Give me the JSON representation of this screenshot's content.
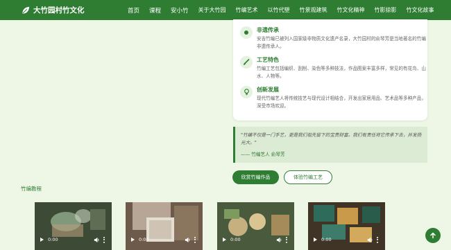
{
  "brand": {
    "title": "大竹园村竹文化",
    "icon": "leaf-icon"
  },
  "nav": {
    "items": [
      {
        "label": "首页",
        "strong": true
      },
      {
        "label": "课程",
        "strong": true
      },
      {
        "label": "安小竹",
        "strong": true
      },
      {
        "label": "关于大竹园",
        "strong": false
      },
      {
        "label": "竹编艺术",
        "strong": false
      },
      {
        "label": "以竹代塑",
        "strong": false
      },
      {
        "label": "竹景观建筑",
        "strong": false
      },
      {
        "label": "竹文化精神",
        "strong": false
      },
      {
        "label": "竹影掠影",
        "strong": false
      },
      {
        "label": "竹文化故事",
        "strong": false
      }
    ]
  },
  "features": [
    {
      "icon": "dot-icon",
      "title": "非遗传承",
      "desc": "安吉竹编已被列入国家级非物质文化遗产名录，大竹园村的俞琴芳是当地著名的竹编非遗传承人。"
    },
    {
      "icon": "brush-icon",
      "title": "工艺特色",
      "desc": "竹编工艺包括编织、刮削、染色等多种技法，作品图案丰富多样，常见的有花鸟、山水、人物等。"
    },
    {
      "icon": "lightbulb-icon",
      "title": "创新发展",
      "desc": "现代竹编艺人将传统技艺与现代设计相结合，开发出家居用品、艺术品等多种产品，深受市场欢迎。"
    }
  ],
  "quote": {
    "text": "\"竹编不仅是一门手艺，更是我们祖先留下的宝贵财富。我们有责任将它传承下去，并发扬光大。\"",
    "author": "—— 竹编艺人 俞琴芳"
  },
  "buttons": {
    "primary": "欣赏竹编作品",
    "secondary": "体验竹编工艺"
  },
  "section": {
    "title": "竹编教程"
  },
  "videos": [
    {
      "time": "0:00"
    },
    {
      "time": "0:00"
    },
    {
      "time": "0:00"
    },
    {
      "time": "0:00"
    }
  ],
  "colors": {
    "primary": "#2e7d32",
    "background": "#eef6e6",
    "quote_bg": "#dcebd3"
  },
  "back_to_top": {
    "icon": "arrow-up-icon"
  }
}
